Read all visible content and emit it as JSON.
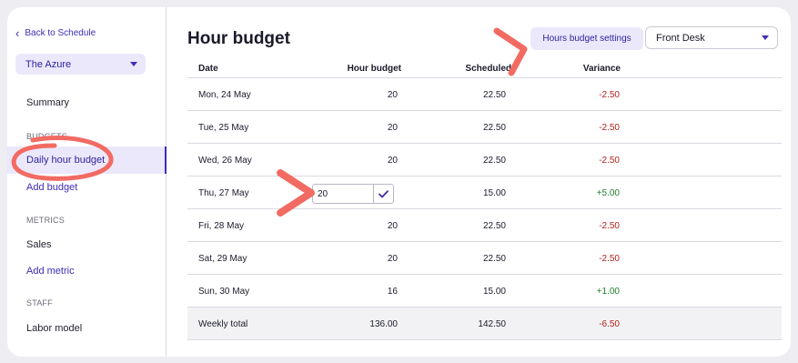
{
  "sidebar": {
    "back_label": "Back to Schedule",
    "venue": "The Azure",
    "items": {
      "summary": "Summary",
      "budgets_section": "BUDGETS",
      "daily_hour_budget": "Daily hour budget",
      "add_budget": "Add budget",
      "metrics_section": "METRICS",
      "sales": "Sales",
      "add_metric": "Add metric",
      "staff_section": "STAFF",
      "labor_model": "Labor model"
    }
  },
  "main": {
    "title": "Hour budget",
    "settings_button": "Hours budget settings",
    "department": "Front Desk"
  },
  "table": {
    "headers": {
      "date": "Date",
      "budget": "Hour budget",
      "scheduled": "Scheduled",
      "variance": "Variance"
    },
    "rows": [
      {
        "date": "Mon, 24 May",
        "budget": "20",
        "scheduled": "22.50",
        "variance": "-2.50"
      },
      {
        "date": "Tue, 25 May",
        "budget": "20",
        "scheduled": "22.50",
        "variance": "-2.50"
      },
      {
        "date": "Wed, 26 May",
        "budget": "20",
        "scheduled": "22.50",
        "variance": "-2.50"
      },
      {
        "date": "Thu, 27 May",
        "budget": "20",
        "scheduled": "15.00",
        "variance": "+5.00"
      },
      {
        "date": "Fri, 28 May",
        "budget": "20",
        "scheduled": "22.50",
        "variance": "-2.50"
      },
      {
        "date": "Sat, 29 May",
        "budget": "20",
        "scheduled": "22.50",
        "variance": "-2.50"
      },
      {
        "date": "Sun, 30 May",
        "budget": "16",
        "scheduled": "15.00",
        "variance": "+1.00"
      }
    ],
    "total": {
      "label": "Weekly total",
      "budget": "136.00",
      "scheduled": "142.50",
      "variance": "-6.50"
    }
  },
  "colors": {
    "accent": "#3d2db8",
    "accent_bg": "#ebe8fb",
    "negative": "#b0221b",
    "positive": "#1e7d2e",
    "annotation": "#f26b63"
  }
}
